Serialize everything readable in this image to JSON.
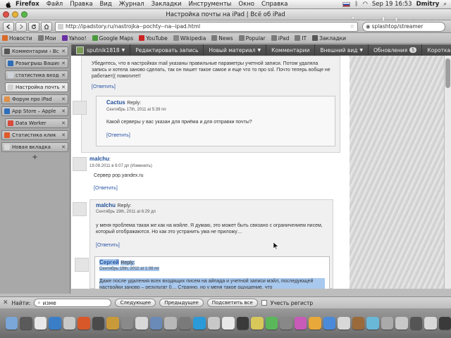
{
  "menubar": {
    "app": "Firefox",
    "items": [
      "Файл",
      "Правка",
      "Вид",
      "Журнал",
      "Закладки",
      "Инструменты",
      "Окно",
      "Справка"
    ],
    "clock": "Sep 19  16:53",
    "user": "Dmitry"
  },
  "window": {
    "title": "Настройка почты на iPad | Всё об iPad"
  },
  "watermark": "ipadstory.ru",
  "nav": {
    "url": "http://ipadstory.ru/nastrojka--pochty--na--ipad.html",
    "search_value": "splashtop/streamer"
  },
  "bookmarks": [
    {
      "label": "Новости",
      "color": "#d86a2a"
    },
    {
      "label": "Мои",
      "color": "#7a7a7a"
    },
    {
      "label": "Yahoo!",
      "color": "#6a2fa2"
    },
    {
      "label": "Google Maps",
      "color": "#4a9a3c"
    },
    {
      "label": "YouTube",
      "color": "#cc2222"
    },
    {
      "label": "Wikipedia",
      "color": "#888888"
    },
    {
      "label": "News",
      "color": "#7a7a7a"
    },
    {
      "label": "Popular",
      "color": "#7a7a7a"
    },
    {
      "label": "iPad",
      "color": "#7a7a7a"
    },
    {
      "label": "IT",
      "color": "#7a7a7a"
    },
    {
      "label": "Закладки",
      "color": "#555555"
    }
  ],
  "tabs": [
    {
      "label": "Комментарии ‹ Вс",
      "color": "#555555",
      "active": false,
      "indent": false
    },
    {
      "label": "Розыгрыш Ваших",
      "color": "#2f6db7",
      "active": false,
      "indent": true
    },
    {
      "label": "статистика вход",
      "color": "#cfd4db",
      "active": false,
      "indent": true
    },
    {
      "label": "Настройка почты",
      "color": "#d0d0d0",
      "active": true,
      "indent": true
    },
    {
      "label": "Форум про iPad",
      "color": "#e0904a",
      "active": false,
      "indent": false
    },
    {
      "label": "App Store – Apple",
      "color": "#2d6fbd",
      "active": false,
      "indent": false
    },
    {
      "label": "Data Worker",
      "color": "#d84a3a",
      "active": false,
      "indent": true
    },
    {
      "label": "Статистика клик",
      "color": "#e05a2a",
      "active": false,
      "indent": false
    },
    {
      "label": "Новая вкладка",
      "color": "#d8d8d8",
      "active": false,
      "indent": false
    }
  ],
  "new_tab": "+",
  "adminbar": {
    "user": "sputnik1818",
    "items": [
      "Редактировать запись",
      "Новый материал",
      "Комментарии",
      "Внешний вид",
      "Обновления",
      "Короткая"
    ],
    "updates_count": "5"
  },
  "comments": {
    "top_text": "Убедитесь, что в настройках mail указаны правильные параметры учетной записи. Потом удаляла запись и хотела заново сделать, так он пишет такое самое и еще что то про ssl. Почто теперь вобще не работает(( помогите!!",
    "reply_label": "[Ответить]",
    "cactus": {
      "author": "Cactus",
      "reply_suffix": "Reply:",
      "meta": "Сентябрь 17th, 2011 at 5:39 пп",
      "text": "Какой серверы у вас указан для приёма и для отправки почты?"
    },
    "malchu": {
      "author": "malchu",
      "suffix": ":",
      "meta": "19.09.2011 в 6:07 дп  (Изменить)",
      "text": "Сервер pop.yandex.ru"
    },
    "malchu_reply": {
      "author": "malchu",
      "reply_suffix": "Reply:",
      "meta": "Сентябрь 19th, 2011 at 6:29 дп",
      "text": "у меня проблема такая же как на мэйле. Я думаю, это может быть связано с ограничением писем, который отображаются. Но как это устранить ума не приложу…"
    },
    "sergey": {
      "author": "Сергей",
      "reply_suffix": "Reply:",
      "meta": "Сентябрь 19th, 2011 at 1:36 пп",
      "text": "Даже после удаления всех входящих писем на айпада и учетной записи мэйл, последующей настройки заново – результат 0… Странно, но у меня такое ощущение, что"
    }
  },
  "findbar": {
    "label": "Найти:",
    "value": "изме",
    "next": "Следующее",
    "prev": "Предыдущее",
    "highlight_all": "Подсветить все",
    "match_case": "Учесть регистр"
  },
  "dock_icons": [
    "#7aa6d8",
    "#5a5a5a",
    "#e8e8e8",
    "#3a7ec8",
    "#c8c8c8",
    "#d8582a",
    "#4a4a4a",
    "#c89a3a",
    "#8a8a8a",
    "#d8d8d8",
    "#6a8ab8",
    "#b8b8b8",
    "#7a7a7a",
    "#2a9ad8",
    "#c8c8c8",
    "#e8e8e8",
    "#3a3a3a",
    "#d8c85a",
    "#5ab85a",
    "#888888",
    "#c85ab8",
    "#e8a83a",
    "#4a8ad8",
    "#d8d8d8",
    "#9a6a3a",
    "#6ab8d8",
    "#aaaaaa",
    "#c8c8c8",
    "#555555",
    "#d8d8d8",
    "#3a3a3a"
  ]
}
